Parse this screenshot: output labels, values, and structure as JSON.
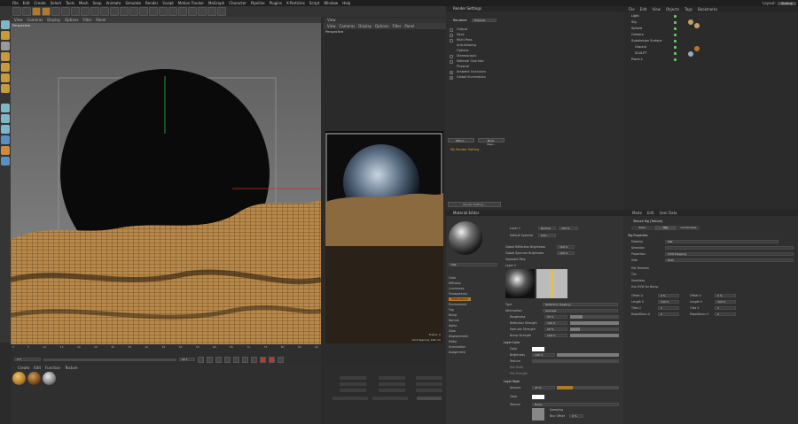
{
  "menubar": {
    "items": [
      "File",
      "Edit",
      "Create",
      "Select",
      "Tools",
      "Mesh",
      "Snap",
      "Animate",
      "Simulate",
      "Render",
      "Sculpt",
      "Motion Tracker",
      "MoGraph",
      "Character",
      "Pipeline",
      "Plugins",
      "X-Particles",
      "Script",
      "Window",
      "Help"
    ],
    "layout_label": "Layout:",
    "layout_value": "Startup"
  },
  "viewport": {
    "menu": [
      "View",
      "Cameras",
      "Display",
      "Options",
      "Filter",
      "Panel"
    ],
    "label": "Perspective"
  },
  "timeline": {
    "ticks": [
      "0",
      "5",
      "10",
      "15",
      "20",
      "25",
      "30",
      "35",
      "40",
      "45",
      "50",
      "55",
      "60",
      "65",
      "70",
      "75",
      "80",
      "85",
      "90"
    ],
    "start": "0 F",
    "current": "0 F",
    "end": "90 F",
    "end2": "90 F",
    "frame_display": "0 F"
  },
  "material_manager": {
    "menu": [
      "Create",
      "Edit",
      "Function",
      "Texture"
    ]
  },
  "picture_viewer": {
    "title": "View",
    "menu": [
      "View",
      "Cameras",
      "Display",
      "Options",
      "Filter",
      "Panel"
    ],
    "label": "Perspective",
    "frame": "Frame: 0",
    "grid": "Grid Spacing: 100 cm"
  },
  "render_settings": {
    "title": "Render Settings",
    "renderer_label": "Renderer",
    "renderer_value": "Physical",
    "items": [
      "Output",
      "Save",
      "Multi-Pass",
      "Anti-Aliasing",
      "Options",
      "Stereoscopic",
      "Material Override",
      "Physical",
      "Ambient Occlusion",
      "Global Illumination"
    ],
    "buttons": [
      "Effect...",
      "Multi-Pass..."
    ],
    "preset": "My Render Setting",
    "footer": "Render Setting..."
  },
  "material_editor": {
    "title": "Material Editor",
    "name": "Mat",
    "channels": [
      "Color",
      "Diffusion",
      "Luminance",
      "Transparency",
      "Reflectance",
      "Environment",
      "Fog",
      "Bump",
      "Normal",
      "Alpha",
      "Glow",
      "Displacement",
      "Editor",
      "Illumination",
      "Assignment"
    ],
    "layer1_label": "Layer 1",
    "layer1_mode": "Normal",
    "layer1_pct": "100 %",
    "default_specular": "Default Specular",
    "add": "Add...",
    "gr_brightness": "Global Reflection Brightness",
    "gsb": "Global Specular Brightness",
    "separate_pass": "Separate Pass",
    "gr_value": "100 %",
    "gs_value": "100 %",
    "layer2_label": "Layer 2",
    "type_label": "Type",
    "type_value": "Reflection (Legacy)",
    "attenuation_label": "Attenuation",
    "attenuation_value": "Average",
    "roughness": "Roughness",
    "roughness_v": "25 %",
    "refl_strength": "Reflection Strength",
    "refl_strength_v": "100 %",
    "spec_strength": "Specular Strength",
    "spec_strength_v": "20 %",
    "bump_strength": "Bump Strength",
    "bump_strength_v": "100 %",
    "layer_color": "Layer Color",
    "color": "Color",
    "brightness": "Brightness",
    "brightness_v": "100 %",
    "texture": "Texture",
    "mix_mode": "Mix Mode",
    "mix_strength": "Mix Strength",
    "layer_mask": "Layer Mask",
    "amount": "Amount",
    "amount_v": "25 %",
    "mask_color": "Color",
    "mask_texture": "Texture",
    "noise": "Noise",
    "sampling": "Sampling",
    "blur_offset": "Blur Offset",
    "blur_offset_v": "0 %"
  },
  "object_manager": {
    "menu": [
      "File",
      "Edit",
      "View",
      "Objects",
      "Tags",
      "Bookmarks"
    ],
    "objects": [
      "Light",
      "Sky",
      "Sphere",
      "Camera",
      "Subdivision Surface",
      "Ground",
      "SCULPT",
      "Plane.1"
    ]
  },
  "attributes": {
    "menu": [
      "Mode",
      "Edit",
      "User Data"
    ],
    "title": "Texture Tag [Texture]",
    "tabs": [
      "Basic",
      "Tag",
      "Coordinates"
    ],
    "section": "Tag Properties",
    "rows": [
      "Material",
      "Selection",
      "Projection",
      "Side",
      "Mix Textures",
      "Tile",
      "Seamless",
      "Use UVW for Bump"
    ],
    "material_value": "Mat",
    "projection_value": "UVW Mapping",
    "side_value": "Both",
    "offset_u": "Offset U",
    "offset_u_v": "0 %",
    "offset_v": "Offset V",
    "offset_v_v": "0 %",
    "length_u": "Length U",
    "length_u_v": "100 %",
    "length_v": "Length V",
    "length_v_v": "100 %",
    "tiles_u": "Tiles U",
    "tiles_u_v": "1",
    "tiles_v": "Tiles V",
    "tiles_v_v": "1",
    "repetitions_u": "Repetitions U",
    "repetitions_u_v": "0",
    "repetitions_v": "Repetitions V",
    "repetitions_v_v": "0"
  }
}
